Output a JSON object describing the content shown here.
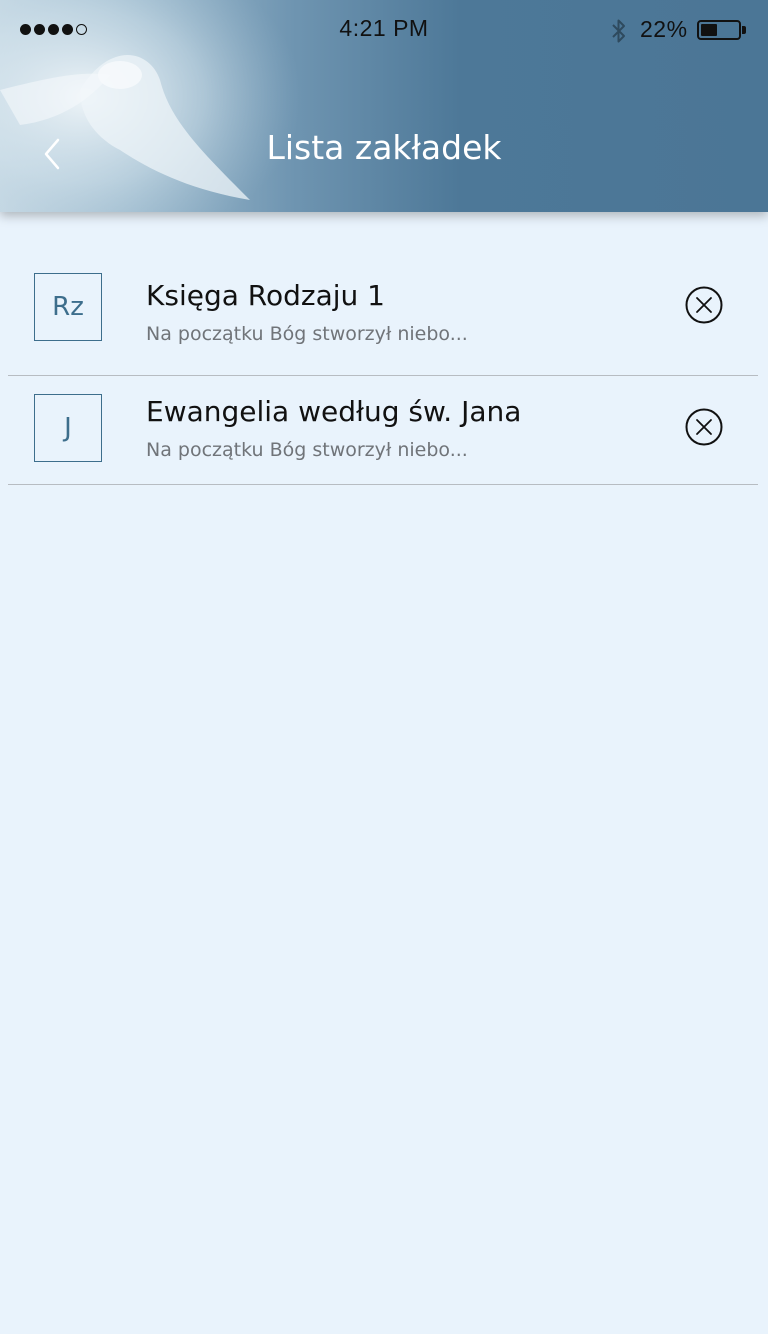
{
  "status_bar": {
    "signal_filled": 4,
    "signal_total": 5,
    "time": "4:21 PM",
    "battery_percent_label": "22%",
    "battery_level": 0.22,
    "bluetooth_icon": "bluetooth-icon"
  },
  "nav": {
    "back_icon": "chevron-left-icon",
    "title": "Lista zakładek"
  },
  "bookmarks": [
    {
      "abbr": "Rz",
      "title": "Księga Rodzaju 1",
      "excerpt": "Na początku Bóg stworzył niebo...",
      "remove_icon": "remove-circle-x-icon"
    },
    {
      "abbr": "J",
      "title": "Ewangelia według św. Jana",
      "excerpt": "Na początku Bóg stworzył niebo...",
      "remove_icon": "remove-circle-x-icon"
    }
  ],
  "colors": {
    "background": "#e9f3fc",
    "header": "#4b7696",
    "accent": "#3d6e8c",
    "title_text": "#111111",
    "subtitle_text": "#707479"
  }
}
